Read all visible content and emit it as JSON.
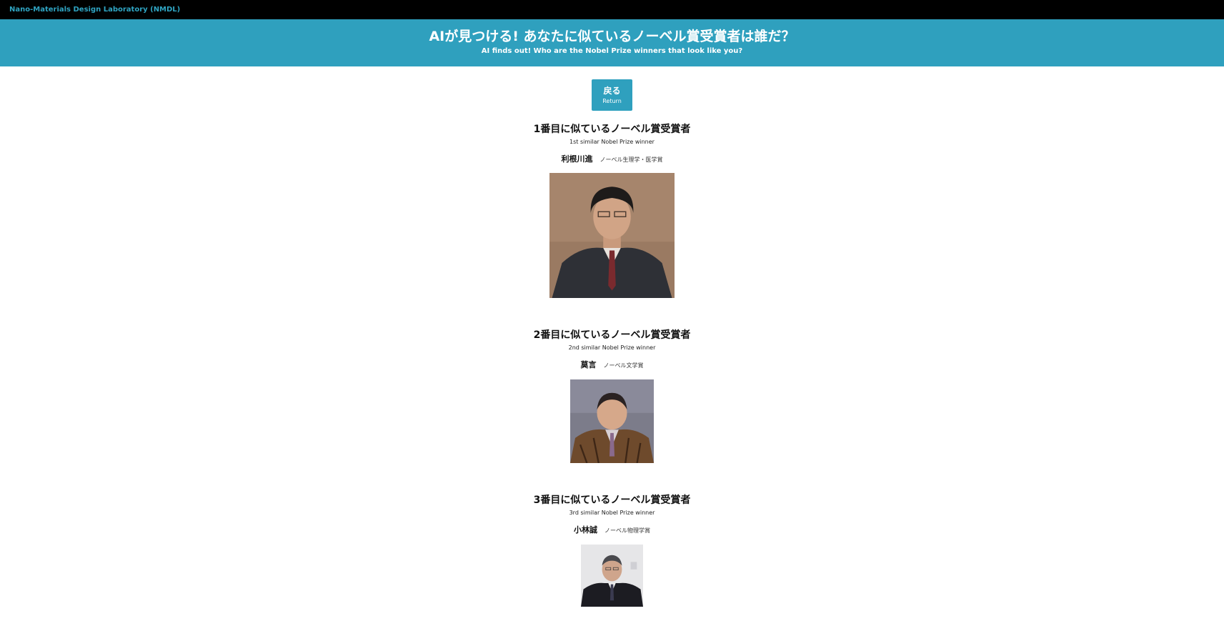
{
  "topbar": {
    "brand": "Nano-Materials Design Laboratory (NMDL)"
  },
  "hero": {
    "title": "AIが見つける! あなたに似ているノーベル賞受賞者は誰だ？",
    "subtitle": "AI finds out! Who are the Nobel Prize winners that look like you?"
  },
  "back_button": {
    "label_jp": "戻る",
    "label_en": "Return"
  },
  "results": [
    {
      "title": "1番目に似ているノーベル賞受賞者",
      "subtitle": "1st similar Nobel Prize winner",
      "name": "利根川進",
      "prize": "ノーベル生理学・医学賞"
    },
    {
      "title": "2番目に似ているノーベル賞受賞者",
      "subtitle": "2nd similar Nobel Prize winner",
      "name": "莫言",
      "prize": "ノーベル文学賞"
    },
    {
      "title": "3番目に似ているノーベル賞受賞者",
      "subtitle": "3rd similar Nobel Prize winner",
      "name": "小林誠",
      "prize": "ノーベル物理学賞"
    }
  ],
  "colors": {
    "topbar_bg": "#000000",
    "brand_text": "#2fa4c2",
    "accent": "#2fa0be"
  }
}
